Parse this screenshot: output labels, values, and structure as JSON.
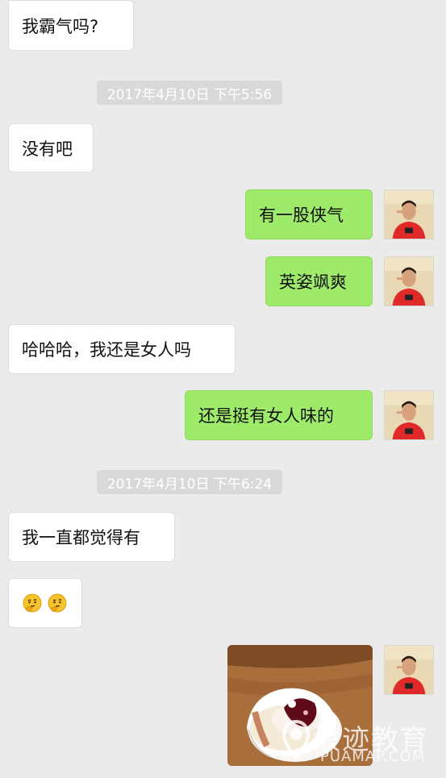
{
  "chat": {
    "messages": [
      {
        "id": "m1",
        "side": "left",
        "text": "我霸气吗?"
      },
      {
        "id": "t1",
        "type": "time",
        "text": "2017年4月10日 下午5:56"
      },
      {
        "id": "m2",
        "side": "left",
        "text": "没有吧"
      },
      {
        "id": "m3",
        "side": "right",
        "text": "有一股侠气"
      },
      {
        "id": "m4",
        "side": "right",
        "text": "英姿飒爽"
      },
      {
        "id": "m5",
        "side": "left",
        "text": "哈哈哈，我还是女人吗"
      },
      {
        "id": "m6",
        "side": "right",
        "text": "还是挺有女人味的"
      },
      {
        "id": "t2",
        "type": "time",
        "text": "2017年4月10日 下午6:24"
      },
      {
        "id": "m7",
        "side": "left",
        "text": "我一直都觉得有"
      },
      {
        "id": "m8",
        "side": "left",
        "type": "emoji",
        "icons": [
          "thinking-face-icon",
          "thinking-face-icon"
        ]
      },
      {
        "id": "m9",
        "side": "right",
        "type": "image",
        "description": "cupcake-photo"
      }
    ]
  },
  "watermark": {
    "main": "浪迹教育",
    "sub": "PUAMAP.COM"
  },
  "colors": {
    "background": "#ebebeb",
    "bubble_left": "#ffffff",
    "bubble_right": "#9eea6a",
    "timestamp_bg": "#d9d9d9"
  }
}
